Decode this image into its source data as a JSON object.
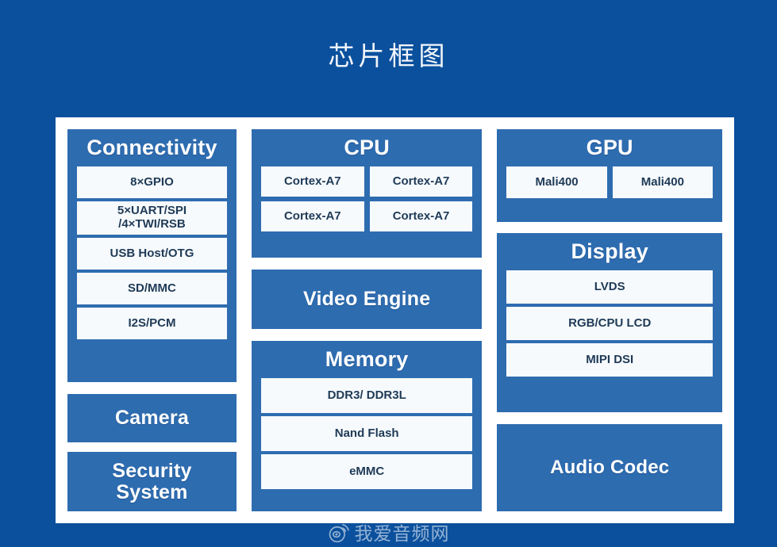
{
  "title": "芯片框图",
  "colors": {
    "background": "#0b509d",
    "panel": "#ffffff",
    "block": "#2e6cb0",
    "chip": "#f6fafd",
    "chip_text": "#1f3a56",
    "block_title": "#ffffff"
  },
  "diagram": {
    "columns": [
      {
        "name": "left",
        "blocks": [
          {
            "id": "connectivity",
            "title": "Connectivity",
            "items": [
              "8×GPIO",
              "5×UART/SPI\n/4×TWI/RSB",
              "USB Host/OTG",
              "SD/MMC",
              "I2S/PCM"
            ]
          },
          {
            "id": "camera",
            "title": "Camera",
            "items": []
          },
          {
            "id": "security",
            "title": "Security System",
            "items": []
          }
        ]
      },
      {
        "name": "middle",
        "blocks": [
          {
            "id": "cpu",
            "title": "CPU",
            "items": [
              "Cortex-A7",
              "Cortex-A7",
              "Cortex-A7",
              "Cortex-A7"
            ]
          },
          {
            "id": "video-engine",
            "title": "Video Engine",
            "items": []
          },
          {
            "id": "memory",
            "title": "Memory",
            "items": [
              "DDR3/ DDR3L",
              "Nand Flash",
              "eMMC"
            ]
          }
        ]
      },
      {
        "name": "right",
        "blocks": [
          {
            "id": "gpu",
            "title": "GPU",
            "items": [
              "Mali400",
              "Mali400"
            ]
          },
          {
            "id": "display",
            "title": "Display",
            "items": [
              "LVDS",
              "RGB/CPU LCD",
              "MIPI DSI"
            ]
          },
          {
            "id": "audio-codec",
            "title": "Audio Codec",
            "items": []
          }
        ]
      }
    ]
  },
  "connectivity": {
    "title": "Connectivity",
    "gpio": "8×GPIO",
    "uart_line1": "5×UART/SPI",
    "uart_line2": "/4×TWI/RSB",
    "usb": "USB Host/OTG",
    "sdmmc": "SD/MMC",
    "i2s": "I2S/PCM"
  },
  "camera": {
    "title": "Camera"
  },
  "security": {
    "title_line1": "Security",
    "title_line2": "System"
  },
  "cpu": {
    "title": "CPU",
    "core1": "Cortex-A7",
    "core2": "Cortex-A7",
    "core3": "Cortex-A7",
    "core4": "Cortex-A7"
  },
  "video_engine": {
    "title": "Video Engine"
  },
  "memory": {
    "title": "Memory",
    "ddr": "DDR3/ DDR3L",
    "nand": "Nand Flash",
    "emmc": "eMMC"
  },
  "gpu": {
    "title": "GPU",
    "mali1": "Mali400",
    "mali2": "Mali400"
  },
  "display": {
    "title": "Display",
    "lvds": "LVDS",
    "rgb": "RGB/CPU LCD",
    "mipi": "MIPI DSI"
  },
  "audio": {
    "title": "Audio Codec"
  },
  "watermark": {
    "text": "我爱音频网",
    "icon": "weibo-icon"
  }
}
